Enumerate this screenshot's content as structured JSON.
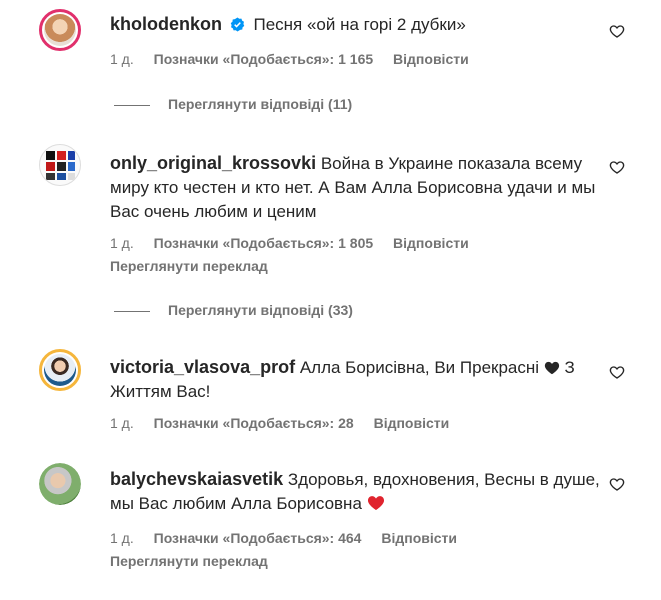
{
  "comments": [
    {
      "username": "kholodenkon",
      "verified": true,
      "text": "Песня «ой на горі 2 дубки»",
      "time": "1 д.",
      "likes": "Позначки «Подобається»: 1 165",
      "reply": "Відповісти",
      "view_replies": "Переглянути відповіді (11)"
    },
    {
      "username": "only_original_krossovki",
      "text": "Война в Украине показала всему миру кто честен и кто нет. А Вам Алла Борисовна удачи и мы Вас очень любим и ценим",
      "time": "1 д.",
      "likes": "Позначки «Подобається»: 1 805",
      "reply": "Відповісти",
      "translate": "Переглянути переклад",
      "view_replies": "Переглянути відповіді (33)"
    },
    {
      "username": "victoria_vlasova_prof",
      "text": "Алла Борисівна, Ви Прекрасні",
      "text_after": "З Життям Вас!",
      "time": "1 д.",
      "likes": "Позначки «Подобається»: 28",
      "reply": "Відповісти"
    },
    {
      "username": "balychevskaiasvetik",
      "text": "Здоровья, вдохновения, Весны в душе, мы Вас любим Алла Борисовна",
      "time": "1 д.",
      "likes": "Позначки «Подобається»: 464",
      "reply": "Відповісти",
      "translate": "Переглянути переклад"
    }
  ],
  "colors": {
    "text": "#262626",
    "muted": "#737373",
    "story_ring": "#e1306c",
    "verified": "#0095f6",
    "heart_red": "#e0242e"
  }
}
